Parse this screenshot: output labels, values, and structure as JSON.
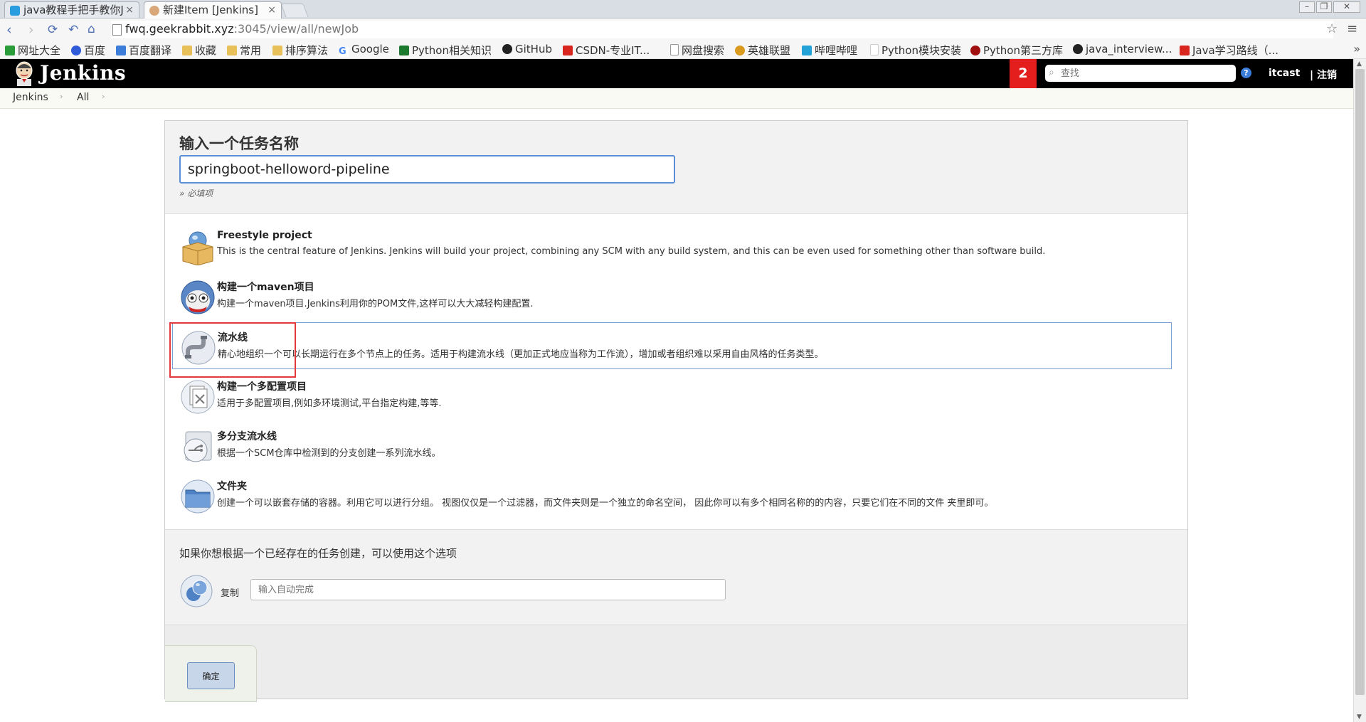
{
  "browser": {
    "tabs": [
      {
        "title": "java教程手把手教你J",
        "active": false
      },
      {
        "title": "新建Item [Jenkins]",
        "active": true
      }
    ],
    "close_glyph": "×",
    "url_host": "fwq.geekrabbit.xyz",
    "url_rest": ":3045/view/all/newJob",
    "bookmarks": [
      {
        "label": "网址大全",
        "icon": "grid-icon",
        "color": "#2a9d3a"
      },
      {
        "label": "百度",
        "icon": "paw-icon",
        "color": "#2f5bd8"
      },
      {
        "label": "百度翻译",
        "icon": "translate-icon",
        "color": "#3b7dd8"
      },
      {
        "label": "收藏",
        "icon": "folder-icon",
        "color": "#e8c05a"
      },
      {
        "label": "常用",
        "icon": "folder-icon",
        "color": "#e8c05a"
      },
      {
        "label": "排序算法",
        "icon": "folder-icon",
        "color": "#e8c05a"
      },
      {
        "label": "Google",
        "icon": "google-icon",
        "color": "#4285f4"
      },
      {
        "label": "Python相关知识",
        "icon": "fc-icon",
        "color": "#1b7a2d"
      },
      {
        "label": "GitHub",
        "icon": "github-icon",
        "color": "#222222"
      },
      {
        "label": "CSDN-专业IT...",
        "icon": "csdn-icon",
        "color": "#d8251d"
      },
      {
        "label": "网盘搜索",
        "icon": "page-icon",
        "color": "#ffffff"
      },
      {
        "label": "英雄联盟",
        "icon": "lol-icon",
        "color": "#d99a1e"
      },
      {
        "label": "哔哩哔哩",
        "icon": "bilibili-icon",
        "color": "#23a2d8"
      },
      {
        "label": "Python模块安装",
        "icon": "page-icon",
        "color": "#ffffff"
      },
      {
        "label": "Python第三方库",
        "icon": "python-icon",
        "color": "#a01010"
      },
      {
        "label": "java_interview...",
        "icon": "github-icon",
        "color": "#222222"
      },
      {
        "label": "Java学习路线（...",
        "icon": "csdn-icon",
        "color": "#d8251d"
      }
    ]
  },
  "header": {
    "logo_text": "Jenkins",
    "notification_count": "2",
    "search_placeholder": "查找",
    "help_label": "?",
    "user": "itcast",
    "logout": "| 注销"
  },
  "breadcrumb": {
    "items": [
      "Jenkins",
      "All"
    ],
    "separator": "›"
  },
  "form": {
    "title": "输入一个任务名称",
    "item_name": "springboot-helloword-pipeline",
    "required_note": "» 必填项",
    "item_types": [
      {
        "name": "Freestyle project",
        "description": "This is the central feature of Jenkins. Jenkins will build your project, combining any SCM with any build system, and this can be even used for something other than software build.",
        "icon": "freestyle-box-icon",
        "selected": false
      },
      {
        "name": "构建一个maven项目",
        "description": "构建一个maven项目.Jenkins利用你的POM文件,这样可以大大减轻构建配置.",
        "icon": "maven-owl-icon",
        "selected": false
      },
      {
        "name": "流水线",
        "description": "精心地组织一个可以长期运行在多个节点上的任务。适用于构建流水线（更加正式地应当称为工作流），增加或者组织难以采用自由风格的任务类型。",
        "icon": "pipeline-icon",
        "selected": true
      },
      {
        "name": "构建一个多配置项目",
        "description": "适用于多配置项目,例如多环境测试,平台指定构建,等等.",
        "icon": "multi-config-icon",
        "selected": false
      },
      {
        "name": "多分支流水线",
        "description": "根据一个SCM仓库中检测到的分支创建一系列流水线。",
        "icon": "multibranch-pipeline-icon",
        "selected": false
      },
      {
        "name": "文件夹",
        "description": "创建一个可以嵌套存储的容器。利用它可以进行分组。 视图仅仅是一个过滤器，而文件夹则是一个独立的命名空间， 因此你可以有多个相同名称的的内容，只要它们在不同的文件 夹里即可。",
        "icon": "folder-icon",
        "selected": false
      }
    ],
    "copy_title": "如果你想根据一个已经存在的任务创建，可以使用这个选项",
    "copy_label": "复制",
    "copy_placeholder": "输入自动完成",
    "ok_label": "确定"
  },
  "colors": {
    "header_bg": "#000000",
    "badge_bg": "#e41d1d",
    "input_focus": "#5b8fd6",
    "highlight_box": "#e23a3a"
  }
}
